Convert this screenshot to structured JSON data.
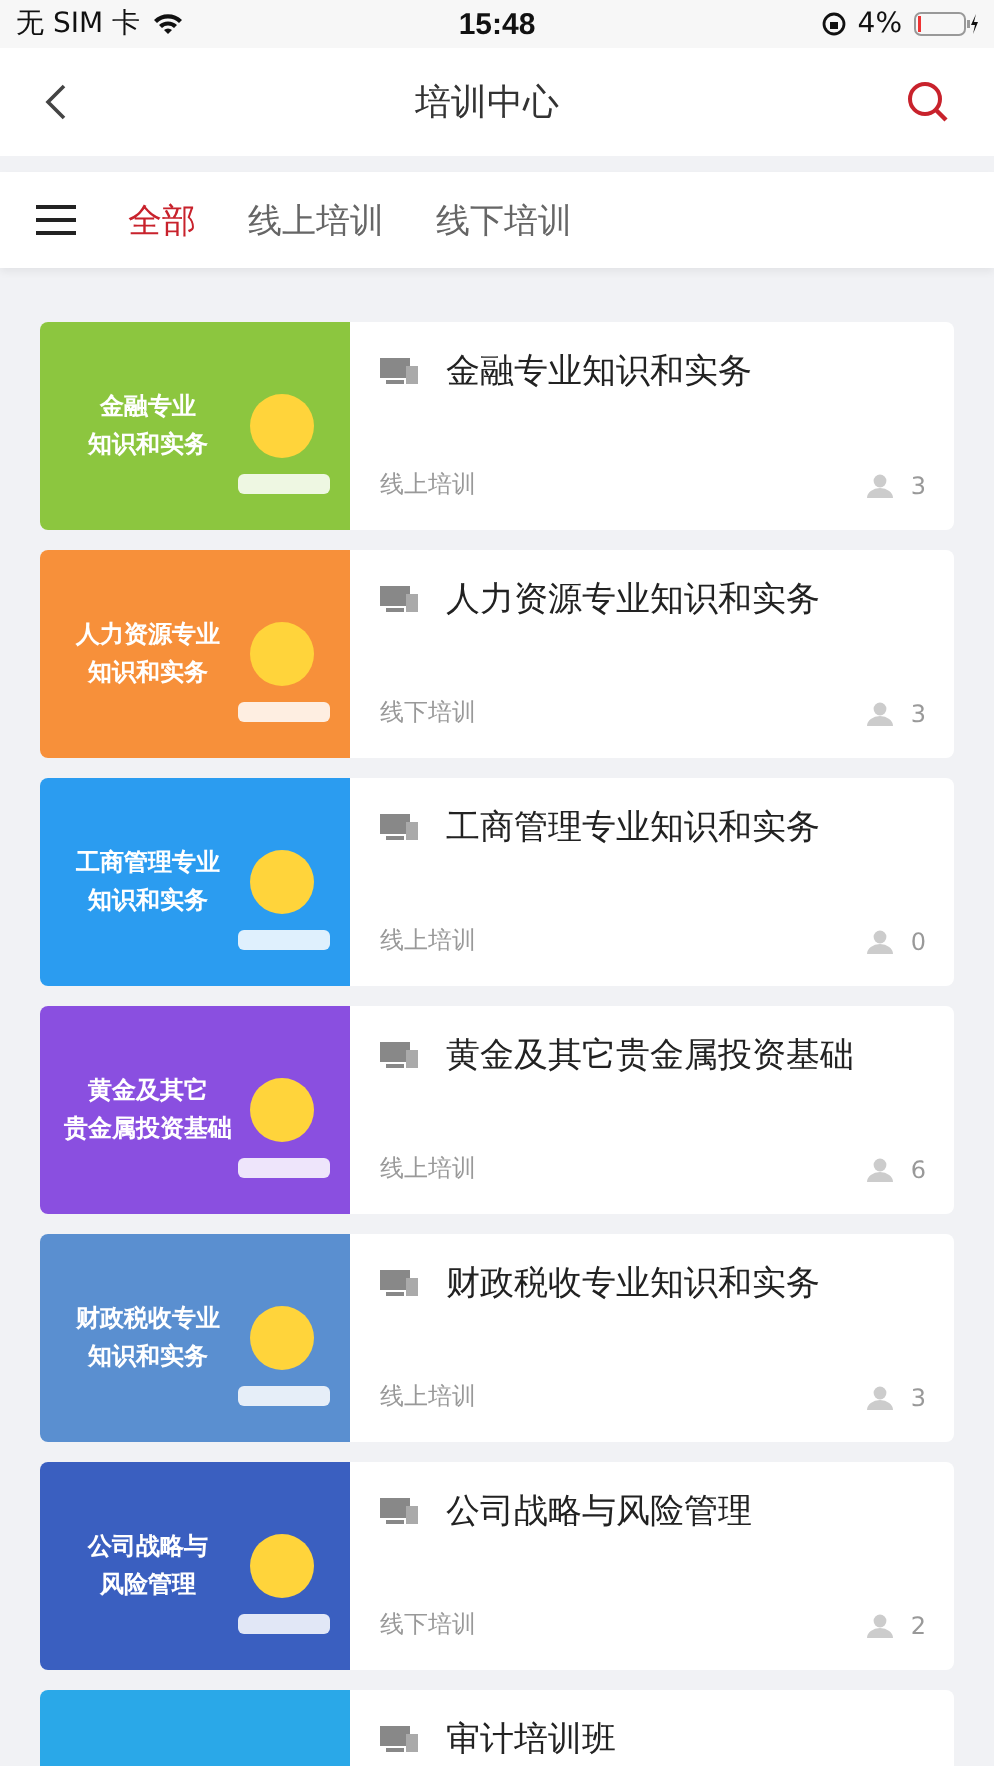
{
  "status_bar": {
    "carrier": "无 SIM 卡",
    "time": "15:48",
    "battery": "4%"
  },
  "nav": {
    "title": "培训中心"
  },
  "tabs": [
    {
      "label": "全部",
      "selected": true
    },
    {
      "label": "线上培训",
      "selected": false
    },
    {
      "label": "线下培训",
      "selected": false
    }
  ],
  "courses": [
    {
      "cover_lines": [
        "金融专业",
        "知识和实务"
      ],
      "color": "#8cc63f",
      "title": "金融专业知识和实务",
      "type": "线上培训",
      "count": "3"
    },
    {
      "cover_lines": [
        "人力资源专业",
        "知识和实务"
      ],
      "color": "#f7903a",
      "title": "人力资源专业知识和实务",
      "type": "线下培训",
      "count": "3"
    },
    {
      "cover_lines": [
        "工商管理专业",
        "知识和实务"
      ],
      "color": "#2b9cf0",
      "title": "工商管理专业知识和实务",
      "type": "线上培训",
      "count": "0"
    },
    {
      "cover_lines": [
        "黄金及其它",
        "贵金属投资基础"
      ],
      "color": "#8a4fe0",
      "title": "黄金及其它贵金属投资基础",
      "type": "线上培训",
      "count": "6"
    },
    {
      "cover_lines": [
        "财政税收专业",
        "知识和实务"
      ],
      "color": "#5a8fd0",
      "title": "财政税收专业知识和实务",
      "type": "线上培训",
      "count": "3"
    },
    {
      "cover_lines": [
        "公司战略与",
        "风险管理"
      ],
      "color": "#3a5fc0",
      "title": "公司战略与风险管理",
      "type": "线下培训",
      "count": "2"
    },
    {
      "color": "#2aa8e8",
      "title": "审计培训班"
    }
  ]
}
